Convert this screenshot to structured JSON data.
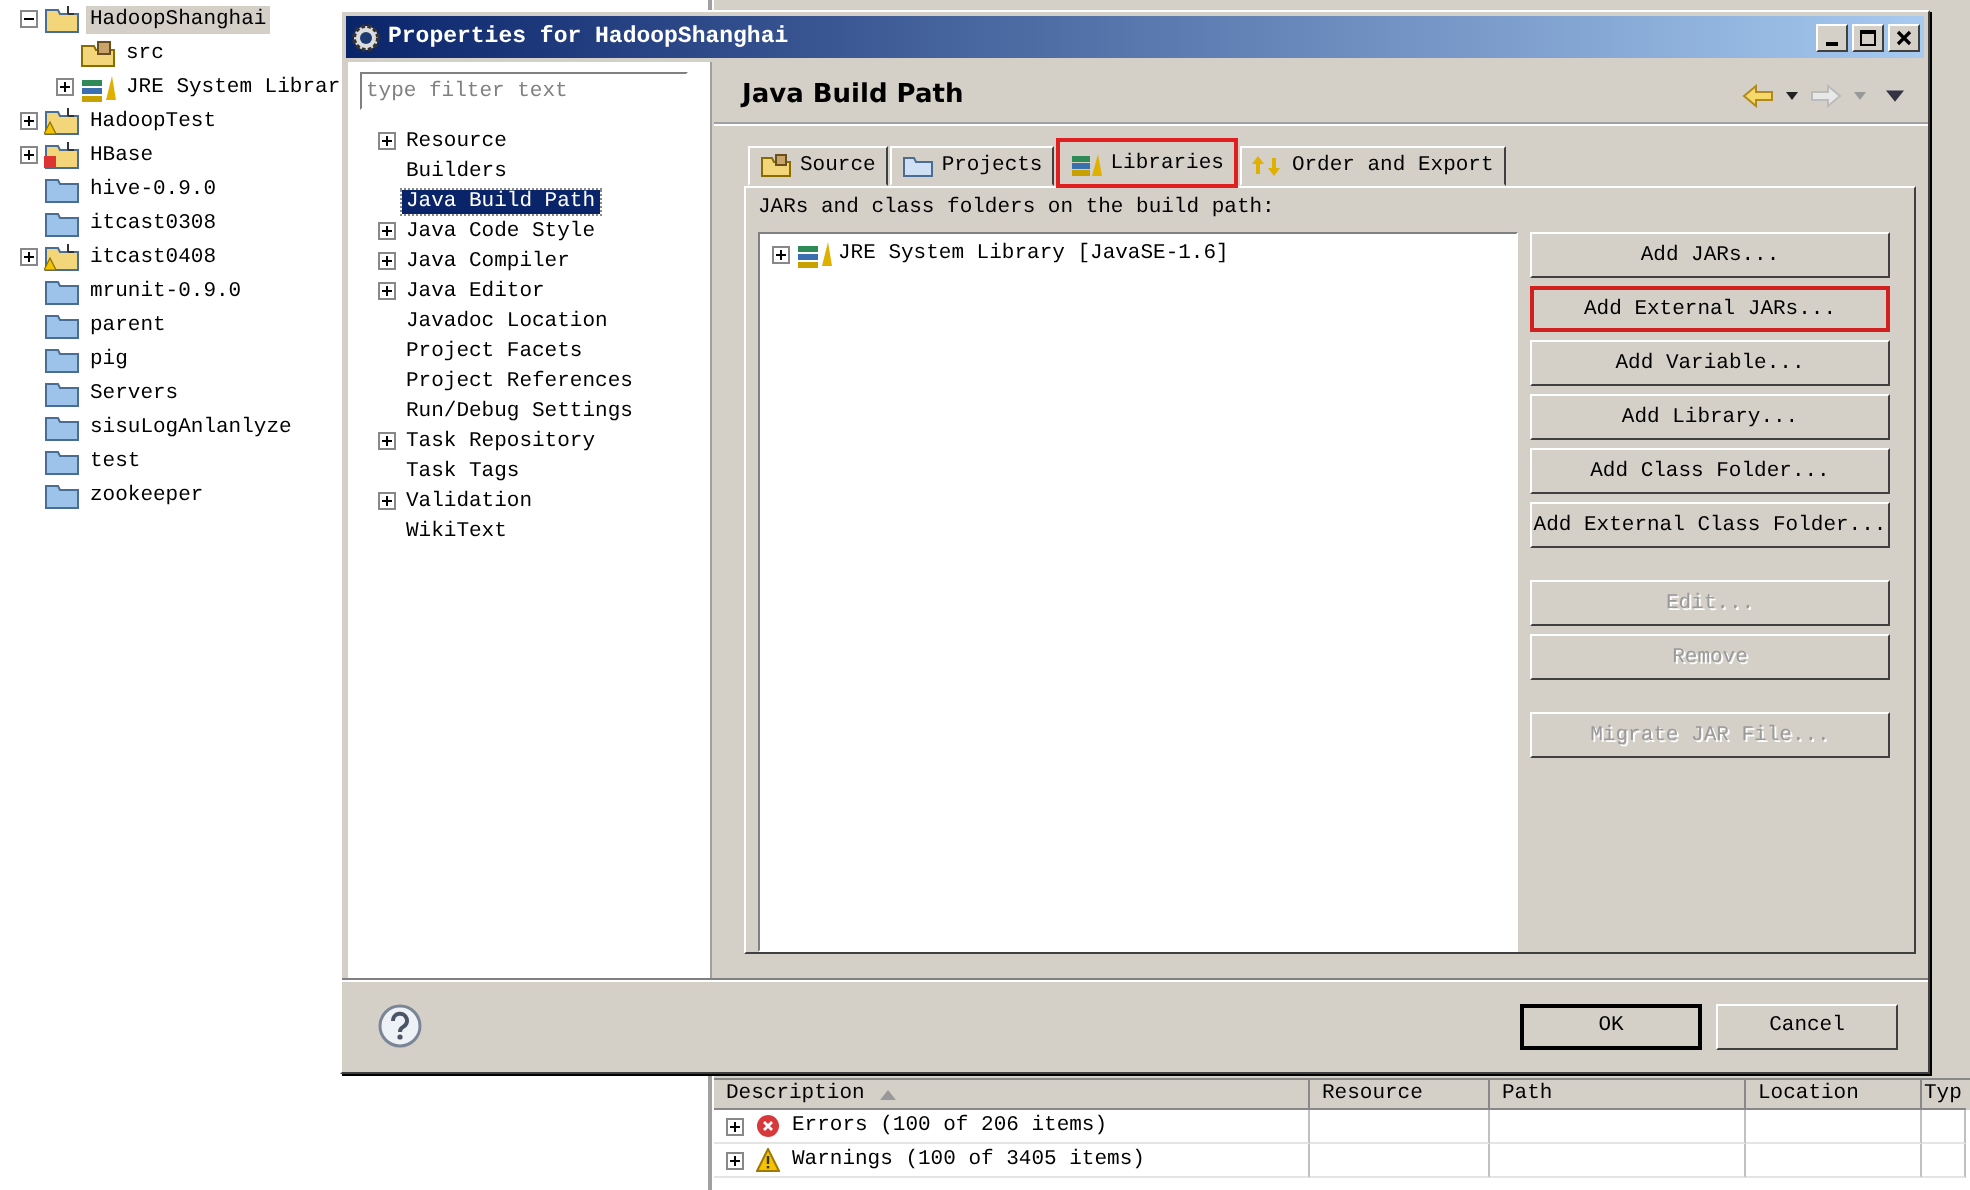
{
  "workspace_tree": {
    "items": [
      {
        "label": "HadoopShanghai",
        "kind": "project",
        "expanded": true,
        "selected": true,
        "children": [
          {
            "label": "src",
            "kind": "package",
            "selected": false
          },
          {
            "label": "JRE System Librar",
            "kind": "library",
            "expanded": false,
            "selected": false
          }
        ]
      },
      {
        "label": "HadoopTest",
        "kind": "project-warning",
        "expanded": false,
        "selected": false
      },
      {
        "label": "HBase",
        "kind": "project-error",
        "expanded": false,
        "selected": false
      },
      {
        "label": "hive-0.9.0",
        "kind": "folder",
        "selected": false
      },
      {
        "label": "itcast0308",
        "kind": "folder",
        "selected": false
      },
      {
        "label": "itcast0408",
        "kind": "project-warning",
        "expanded": false,
        "selected": false
      },
      {
        "label": "mrunit-0.9.0",
        "kind": "folder",
        "selected": false
      },
      {
        "label": "parent",
        "kind": "folder",
        "selected": false
      },
      {
        "label": "pig",
        "kind": "folder",
        "selected": false
      },
      {
        "label": "Servers",
        "kind": "folder",
        "selected": false
      },
      {
        "label": "sisuLogAnlanlyze",
        "kind": "folder",
        "selected": false
      },
      {
        "label": "test",
        "kind": "folder",
        "selected": false
      },
      {
        "label": "zookeeper",
        "kind": "folder",
        "selected": false
      }
    ]
  },
  "dialog": {
    "title": "Properties for HadoopShanghai",
    "filter": {
      "placeholder": "type filter text"
    },
    "nav_tree": [
      {
        "label": "Resource",
        "expanded": false,
        "selected": false
      },
      {
        "label": "Builders",
        "selected": false
      },
      {
        "label": "Java Build Path",
        "selected": true
      },
      {
        "label": "Java Code Style",
        "expanded": false,
        "selected": false
      },
      {
        "label": "Java Compiler",
        "expanded": false,
        "selected": false
      },
      {
        "label": "Java Editor",
        "expanded": false,
        "selected": false
      },
      {
        "label": "Javadoc Location",
        "selected": false
      },
      {
        "label": "Project Facets",
        "selected": false
      },
      {
        "label": "Project References",
        "selected": false
      },
      {
        "label": "Run/Debug Settings",
        "selected": false
      },
      {
        "label": "Task Repository",
        "expanded": false,
        "selected": false
      },
      {
        "label": "Task Tags",
        "selected": false
      },
      {
        "label": "Validation",
        "expanded": false,
        "selected": false
      },
      {
        "label": "WikiText",
        "selected": false
      }
    ],
    "page_title": "Java Build Path",
    "tabs": [
      {
        "label": "Source",
        "kind": "source",
        "selected": false,
        "highlighted": false
      },
      {
        "label": "Projects",
        "kind": "projects",
        "selected": false,
        "highlighted": false
      },
      {
        "label": "Libraries",
        "kind": "libraries",
        "selected": true,
        "highlighted": true
      },
      {
        "label": "Order and Export",
        "kind": "order",
        "selected": false,
        "highlighted": false
      }
    ],
    "list_label": "JARs and class folders on the build path:",
    "entries": [
      {
        "label": "JRE System Library [JavaSE-1.6]",
        "expanded": false
      }
    ],
    "button_groups": [
      [
        {
          "label": "Add JARs...",
          "disabled": false,
          "highlighted": false
        },
        {
          "label": "Add External JARs...",
          "disabled": false,
          "highlighted": true
        },
        {
          "label": "Add Variable...",
          "disabled": false,
          "highlighted": false
        },
        {
          "label": "Add Library...",
          "disabled": false,
          "highlighted": false
        },
        {
          "label": "Add Class Folder...",
          "disabled": false,
          "highlighted": false
        },
        {
          "label": "Add External Class Folder...",
          "disabled": false,
          "highlighted": false
        }
      ],
      [
        {
          "label": "Edit...",
          "disabled": true,
          "highlighted": false
        },
        {
          "label": "Remove",
          "disabled": true,
          "highlighted": false
        }
      ],
      [
        {
          "label": "Migrate JAR File...",
          "disabled": true,
          "highlighted": false
        }
      ]
    ],
    "footer_buttons": [
      {
        "label": "OK",
        "default": true
      },
      {
        "label": "Cancel",
        "default": false
      }
    ]
  },
  "problems": {
    "columns": [
      {
        "label": "Description",
        "sorted": true
      },
      {
        "label": "Resource",
        "sorted": false
      },
      {
        "label": "Path",
        "sorted": false
      },
      {
        "label": "Location",
        "sorted": false
      },
      {
        "label": "Typ"
      }
    ],
    "rows": [
      {
        "label": "Errors (100 of 206 items)",
        "kind": "error",
        "expanded": false
      },
      {
        "label": "Warnings (100 of 3405 items)",
        "kind": "warning",
        "expanded": false
      }
    ]
  }
}
